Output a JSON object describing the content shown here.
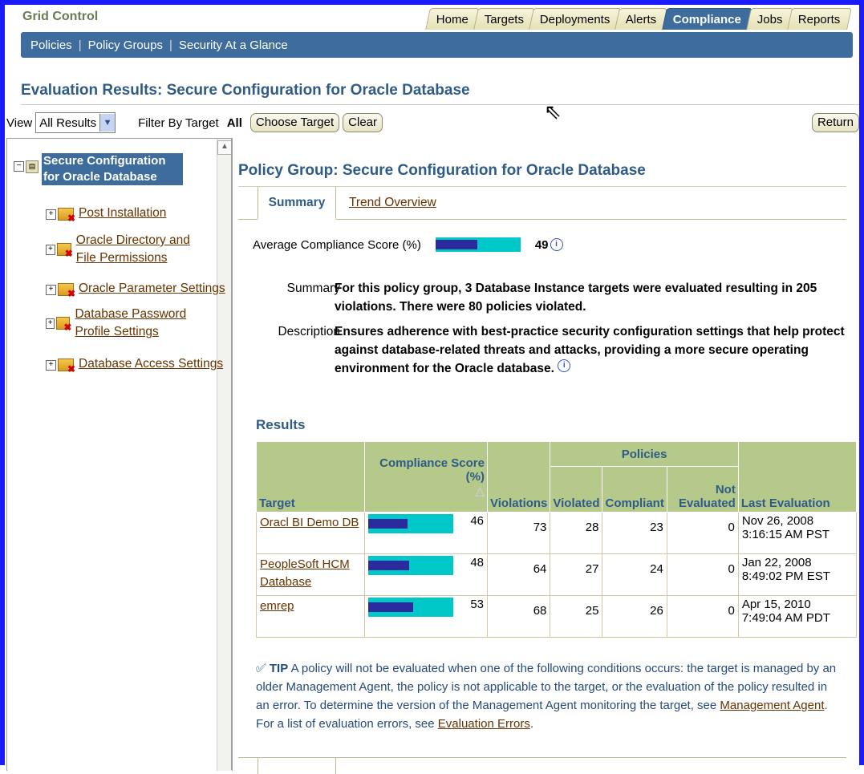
{
  "app": {
    "title": "Grid Control"
  },
  "tabs": [
    {
      "label": "Home",
      "active": false
    },
    {
      "label": "Targets",
      "active": false
    },
    {
      "label": "Deployments",
      "active": false
    },
    {
      "label": "Alerts",
      "active": false
    },
    {
      "label": "Compliance",
      "active": true
    },
    {
      "label": "Jobs",
      "active": false
    },
    {
      "label": "Reports",
      "active": false
    }
  ],
  "subnav": {
    "items": [
      "Policies",
      "Policy Groups",
      "Security At a Glance"
    ],
    "separator": "|"
  },
  "page": {
    "title": "Evaluation Results: Secure Configuration for Oracle Database"
  },
  "filter": {
    "view_label": "View",
    "view_value": "All Results",
    "filter_label": "Filter By Target",
    "filter_value": "All",
    "choose_target": "Choose Target",
    "clear": "Clear",
    "return": "Return"
  },
  "tree": {
    "root": "Secure Configuration for Oracle Database",
    "items": [
      "Post Installation",
      "Oracle Directory and File Permissions",
      "Oracle Parameter Settings",
      "Database Password Profile Settings",
      "Database Access Settings"
    ]
  },
  "main": {
    "title": "Policy Group: Secure Configuration for Oracle Database",
    "tabs": [
      "Summary",
      "Trend Overview"
    ],
    "acs_label": "Average Compliance Score (%)",
    "acs_value": 49,
    "summary_label": "Summary",
    "summary_text": "For this policy group, 3 Database Instance targets were evaluated resulting in 205 violations. There were 80 policies violated.",
    "description_label": "Description",
    "description_text": "Ensures adherence with best-practice security configuration settings that help protect against database-related threats and attacks, providing a more secure operating environment for the Oracle database."
  },
  "results": {
    "title": "Results",
    "headers": {
      "target": "Target",
      "score": "Compliance Score (%)",
      "violations": "Violations",
      "policies": "Policies",
      "violated": "Violated",
      "compliant": "Compliant",
      "not_evaluated": "Not Evaluated",
      "last_evaluation": "Last Evaluation"
    },
    "rows": [
      {
        "target": "Oracl BI Demo DB",
        "score": 46,
        "violations": 73,
        "violated": 28,
        "compliant": 23,
        "not_evaluated": 0,
        "last_evaluation": "Nov 26, 2008 3:16:15 AM PST"
      },
      {
        "target": "PeopleSoft HCM Database",
        "score": 48,
        "violations": 64,
        "violated": 27,
        "compliant": 24,
        "not_evaluated": 0,
        "last_evaluation": "Jan 22, 2008 8:49:02 PM EST"
      },
      {
        "target": "emrep",
        "score": 53,
        "violations": 68,
        "violated": 25,
        "compliant": 26,
        "not_evaluated": 0,
        "last_evaluation": "Apr 15, 2010 7:49:04 AM PDT"
      }
    ]
  },
  "tip": {
    "label": "TIP",
    "text1": "A policy will not be evaluated when one of the following conditions occurs: the target is managed by an older Management Agent, the policy is not applicable to the target, or the evaluation of the policy resulted in an error. To determine the version of the Management Agent monitoring the target, see",
    "link1": "Management Agent",
    "text2": ". For a list of evaluation errors, see",
    "link2": "Evaluation Errors",
    "text3": "."
  },
  "colors": {
    "brand_blue": "#3e6c9c",
    "bar_fill": "#2b2b9e",
    "bar_bg": "#00c8c8",
    "header_green": "#b5c98a"
  }
}
